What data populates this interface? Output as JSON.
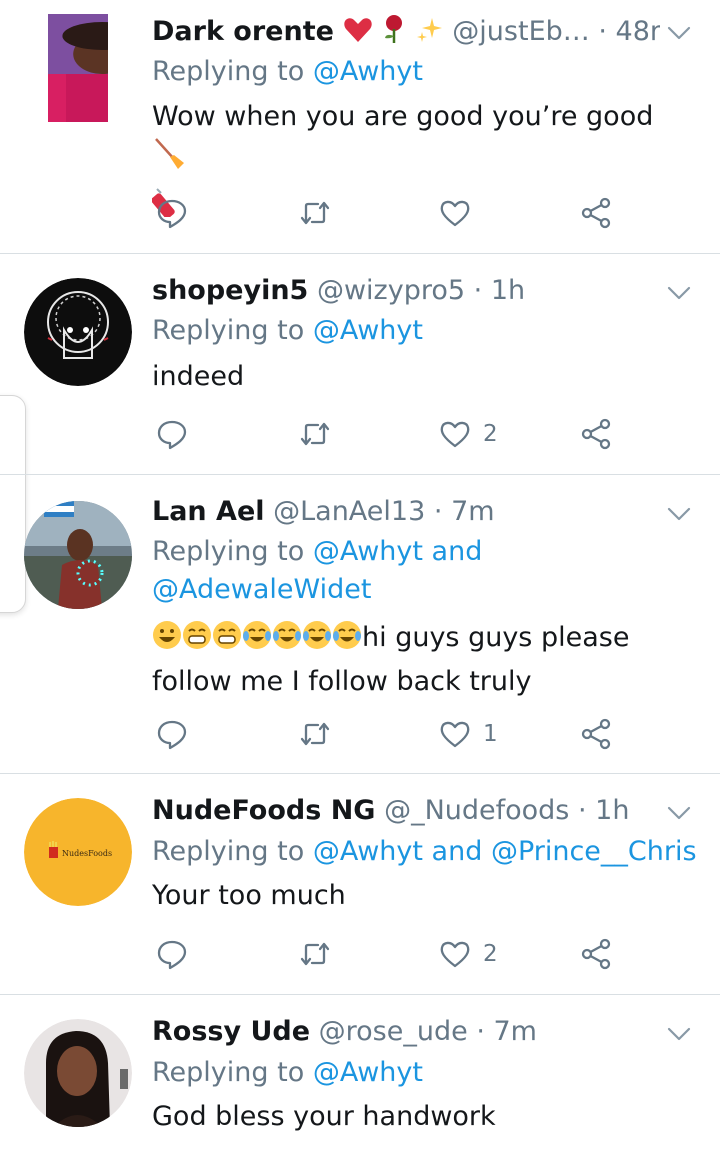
{
  "colors": {
    "link": "#1b95e0",
    "muted": "#657786",
    "text": "#14171a",
    "divider": "#d9dfe3"
  },
  "tweets": [
    {
      "name": "Dark orente",
      "name_emojis": [
        "red-heart-icon",
        "rose-icon",
        "sparkles-icon"
      ],
      "handle": "@justEb…",
      "dot": "·",
      "time": "48m",
      "replying_prefix": "Replying to",
      "mentions": [
        "@Awhyt"
      ],
      "text": "Wow when you are good you’re good",
      "text_emojis": [
        "broom-icon",
        "firecracker-icon"
      ],
      "likes": "",
      "retweets": ""
    },
    {
      "name": "shopeyin5",
      "handle": "@wizypro5",
      "dot": "·",
      "time": "1h",
      "replying_prefix": "Replying to",
      "mentions": [
        "@Awhyt"
      ],
      "text": "indeed",
      "likes": "2"
    },
    {
      "name": "Lan Ael",
      "handle": "@LanAel13",
      "dot": "·",
      "time": "7m",
      "replying_prefix": "Replying to",
      "mentions": [
        "@Awhyt",
        "@AdewaleWidet"
      ],
      "connector": "and",
      "text_emojis": [
        "grinning-face-icon",
        "beaming-face-icon",
        "beaming-face-icon",
        "tears-of-joy-icon",
        "tears-of-joy-icon",
        "tears-of-joy-icon",
        "tears-of-joy-icon"
      ],
      "text_line1": "hi guys guys please",
      "text_line2": "follow me I follow back truly",
      "likes": "1"
    },
    {
      "name": "NudeFoods NG",
      "handle": "@_Nudefoods",
      "dot": "·",
      "time": "1h",
      "replying_prefix": "Replying to",
      "mentions": [
        "@Awhyt",
        "@Prince__Chris"
      ],
      "connector": "and",
      "avatar_text": "NudesFoods",
      "text": "Your too much",
      "likes": "2"
    },
    {
      "name": "Rossy Ude",
      "handle": "@rose_ude",
      "dot": "·",
      "time": "7m",
      "replying_prefix": "Replying to",
      "mentions": [
        "@Awhyt"
      ],
      "text": "God bless your handwork"
    }
  ]
}
